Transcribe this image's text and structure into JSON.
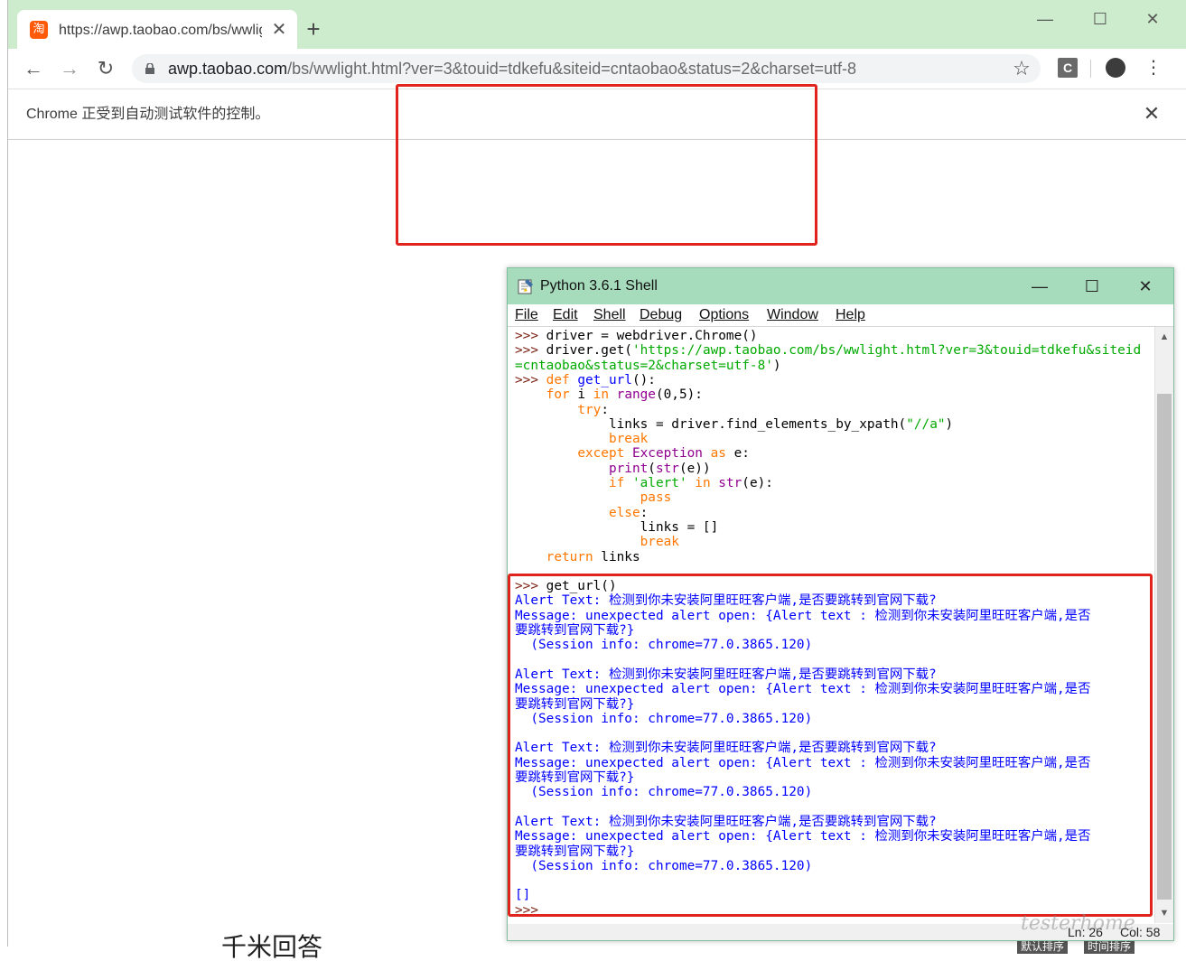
{
  "browser": {
    "tab_title": "https://awp.taobao.com/bs/wwlight.html?ver=3&touid=tdkefu&siteid=cntaobao&status=2&charset=utf-8",
    "tab_favicon_glyph": "淘",
    "new_tab_glyph": "+",
    "close_glyph": "✕",
    "url_host": "awp.taobao.com",
    "url_rest": "/bs/wwlight.html?ver=3&touid=tdkefu&siteid=cntaobao&status=2&charset=utf-8",
    "extension_label": "C",
    "infobar_text": "Chrome 正受到自动测试软件的控制。",
    "accent_tab_strip": "#cdeccd"
  },
  "page": {
    "partial_text": "千米回答",
    "bottom_tags": [
      "默认排序",
      "时间排序"
    ]
  },
  "idle": {
    "title": "Python 3.6.1 Shell",
    "menu": [
      "File",
      "Edit",
      "Shell",
      "Debug",
      "Options",
      "Window",
      "Help"
    ],
    "status_ln": "Ln: 26",
    "status_col": "Col: 58",
    "code_lines": [
      [
        {
          "t": ">>> ",
          "c": "prompt"
        },
        {
          "t": "driver = webdriver.Chrome()",
          "c": "plain"
        }
      ],
      [
        {
          "t": ">>> ",
          "c": "prompt"
        },
        {
          "t": "driver.get(",
          "c": "plain"
        },
        {
          "t": "'https://awp.taobao.com/bs/wwlight.html?ver=3&touid=tdkefu&siteid",
          "c": "string"
        }
      ],
      [
        {
          "t": "=cntaobao&status=2&charset=utf-8'",
          "c": "string"
        },
        {
          "t": ")",
          "c": "plain"
        }
      ],
      [
        {
          "t": ">>> ",
          "c": "prompt"
        },
        {
          "t": "def ",
          "c": "keyword"
        },
        {
          "t": "get_url",
          "c": "def"
        },
        {
          "t": "():",
          "c": "plain"
        }
      ],
      [
        {
          "t": "    ",
          "c": "plain"
        },
        {
          "t": "for",
          "c": "keyword"
        },
        {
          "t": " i ",
          "c": "plain"
        },
        {
          "t": "in",
          "c": "keyword"
        },
        {
          "t": " ",
          "c": "plain"
        },
        {
          "t": "range",
          "c": "builtin"
        },
        {
          "t": "(0,5):",
          "c": "plain"
        }
      ],
      [
        {
          "t": "        ",
          "c": "plain"
        },
        {
          "t": "try",
          "c": "keyword"
        },
        {
          "t": ":",
          "c": "plain"
        }
      ],
      [
        {
          "t": "            links = driver.find_elements_by_xpath(",
          "c": "plain"
        },
        {
          "t": "\"//a\"",
          "c": "string"
        },
        {
          "t": ")",
          "c": "plain"
        }
      ],
      [
        {
          "t": "            ",
          "c": "plain"
        },
        {
          "t": "break",
          "c": "keyword"
        }
      ],
      [
        {
          "t": "        ",
          "c": "plain"
        },
        {
          "t": "except",
          "c": "keyword"
        },
        {
          "t": " ",
          "c": "plain"
        },
        {
          "t": "Exception",
          "c": "builtin"
        },
        {
          "t": " ",
          "c": "plain"
        },
        {
          "t": "as",
          "c": "keyword"
        },
        {
          "t": " e:",
          "c": "plain"
        }
      ],
      [
        {
          "t": "            ",
          "c": "plain"
        },
        {
          "t": "print",
          "c": "builtin"
        },
        {
          "t": "(",
          "c": "plain"
        },
        {
          "t": "str",
          "c": "builtin"
        },
        {
          "t": "(e))",
          "c": "plain"
        }
      ],
      [
        {
          "t": "            ",
          "c": "plain"
        },
        {
          "t": "if",
          "c": "keyword"
        },
        {
          "t": " ",
          "c": "plain"
        },
        {
          "t": "'alert'",
          "c": "string"
        },
        {
          "t": " ",
          "c": "plain"
        },
        {
          "t": "in",
          "c": "keyword"
        },
        {
          "t": " ",
          "c": "plain"
        },
        {
          "t": "str",
          "c": "builtin"
        },
        {
          "t": "(e):",
          "c": "plain"
        }
      ],
      [
        {
          "t": "                ",
          "c": "plain"
        },
        {
          "t": "pass",
          "c": "keyword"
        }
      ],
      [
        {
          "t": "            ",
          "c": "plain"
        },
        {
          "t": "else",
          "c": "keyword"
        },
        {
          "t": ":",
          "c": "plain"
        }
      ],
      [
        {
          "t": "                links = []",
          "c": "plain"
        }
      ],
      [
        {
          "t": "                ",
          "c": "plain"
        },
        {
          "t": "break",
          "c": "keyword"
        }
      ],
      [
        {
          "t": "    ",
          "c": "plain"
        },
        {
          "t": "return",
          "c": "keyword"
        },
        {
          "t": " links",
          "c": "plain"
        }
      ],
      [],
      [
        {
          "t": ">>> ",
          "c": "prompt"
        },
        {
          "t": "get_url()",
          "c": "plain"
        }
      ],
      [
        {
          "t": "Alert Text: 检测到你未安装阿里旺旺客户端,是否要跳转到官网下载?",
          "c": "output"
        }
      ],
      [
        {
          "t": "Message: unexpected alert open: {Alert text : 检测到你未安装阿里旺旺客户端,是否",
          "c": "output"
        }
      ],
      [
        {
          "t": "要跳转到官网下载?}",
          "c": "output"
        }
      ],
      [
        {
          "t": "  (Session info: chrome=77.0.3865.120)",
          "c": "output"
        }
      ],
      [],
      [
        {
          "t": "Alert Text: 检测到你未安装阿里旺旺客户端,是否要跳转到官网下载?",
          "c": "output"
        }
      ],
      [
        {
          "t": "Message: unexpected alert open: {Alert text : 检测到你未安装阿里旺旺客户端,是否",
          "c": "output"
        }
      ],
      [
        {
          "t": "要跳转到官网下载?}",
          "c": "output"
        }
      ],
      [
        {
          "t": "  (Session info: chrome=77.0.3865.120)",
          "c": "output"
        }
      ],
      [],
      [
        {
          "t": "Alert Text: 检测到你未安装阿里旺旺客户端,是否要跳转到官网下载?",
          "c": "output"
        }
      ],
      [
        {
          "t": "Message: unexpected alert open: {Alert text : 检测到你未安装阿里旺旺客户端,是否",
          "c": "output"
        }
      ],
      [
        {
          "t": "要跳转到官网下载?}",
          "c": "output"
        }
      ],
      [
        {
          "t": "  (Session info: chrome=77.0.3865.120)",
          "c": "output"
        }
      ],
      [],
      [
        {
          "t": "Alert Text: 检测到你未安装阿里旺旺客户端,是否要跳转到官网下载?",
          "c": "output"
        }
      ],
      [
        {
          "t": "Message: unexpected alert open: {Alert text : 检测到你未安装阿里旺旺客户端,是否",
          "c": "output"
        }
      ],
      [
        {
          "t": "要跳转到官网下载?}",
          "c": "output"
        }
      ],
      [
        {
          "t": "  (Session info: chrome=77.0.3865.120)",
          "c": "output"
        }
      ],
      [],
      [
        {
          "t": "[]",
          "c": "output"
        }
      ],
      [
        {
          "t": ">>> ",
          "c": "prompt"
        }
      ]
    ],
    "colors": {
      "prompt": "#7a1e0e",
      "plain": "#000000",
      "keyword": "#ff7700",
      "builtin": "#900090",
      "string": "#00aa00",
      "def": "#0000ff",
      "output": "#0000ff"
    }
  },
  "annotations": {
    "highlight_color": "#e0231c"
  },
  "watermark_text": "testerhome"
}
